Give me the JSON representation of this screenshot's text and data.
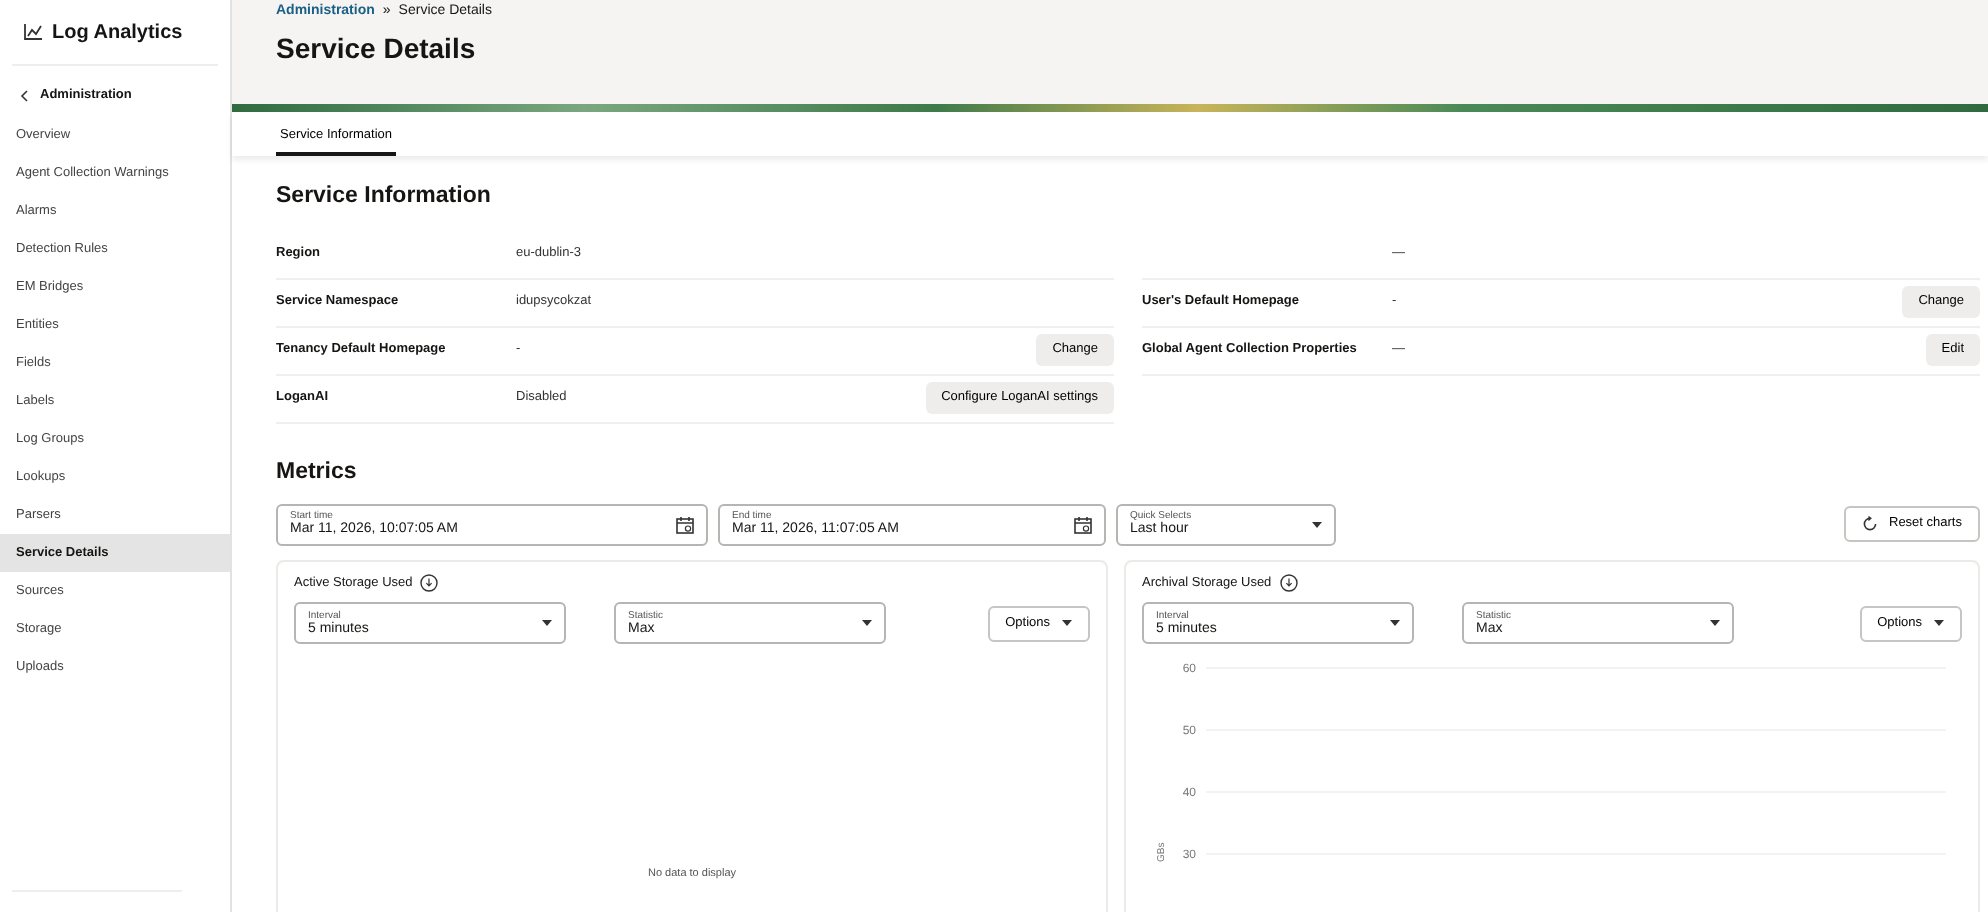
{
  "app": {
    "title": "Log Analytics"
  },
  "sidebar": {
    "back_label": "Administration",
    "items": [
      {
        "label": "Overview",
        "selected": false
      },
      {
        "label": "Agent Collection Warnings",
        "selected": false
      },
      {
        "label": "Alarms",
        "selected": false
      },
      {
        "label": "Detection Rules",
        "selected": false
      },
      {
        "label": "EM Bridges",
        "selected": false
      },
      {
        "label": "Entities",
        "selected": false
      },
      {
        "label": "Fields",
        "selected": false
      },
      {
        "label": "Labels",
        "selected": false
      },
      {
        "label": "Log Groups",
        "selected": false
      },
      {
        "label": "Lookups",
        "selected": false
      },
      {
        "label": "Parsers",
        "selected": false
      },
      {
        "label": "Service Details",
        "selected": true
      },
      {
        "label": "Sources",
        "selected": false
      },
      {
        "label": "Storage",
        "selected": false
      },
      {
        "label": "Uploads",
        "selected": false
      }
    ]
  },
  "breadcrumb": [
    {
      "label": "Administration",
      "kind": "link"
    },
    {
      "separator": "»",
      "label": "Service Details",
      "kind": "current"
    }
  ],
  "page_title": "Service Details",
  "tabs": [
    {
      "label": "Service Information",
      "selected": true
    }
  ],
  "service_information": {
    "title": "Service Information",
    "left_rows": [
      {
        "label": "Region",
        "value": "eu-dublin-3"
      },
      {
        "label": "Service Namespace",
        "value": "idupsycokzat"
      },
      {
        "label": "Tenancy Default Homepage",
        "value": "-",
        "button": "Change"
      },
      {
        "label": "LoganAI",
        "value": "Disabled",
        "button": "Configure LoganAI settings"
      }
    ],
    "right_rows": [
      {
        "value": "—"
      },
      {
        "label": "User's Default Homepage",
        "value": "-",
        "button": "Change"
      },
      {
        "label": "Global Agent Collection Properties",
        "value": "—",
        "button": "Edit"
      }
    ]
  },
  "metrics": {
    "title": "Metrics",
    "start_time": {
      "label": "Start time",
      "value": "Mar 11, 2026, 10:07:05 AM"
    },
    "end_time": {
      "label": "End time",
      "value": "Mar 11, 2026, 11:07:05 AM"
    },
    "quick_selects": {
      "label": "Quick Selects",
      "value": "Last hour"
    },
    "reset_button": "Reset charts",
    "charts": [
      {
        "title": "Active Storage Used",
        "interval": {
          "label": "Interval",
          "value": "5 minutes"
        },
        "statistic": {
          "label": "Statistic",
          "value": "Max"
        },
        "options_button": "Options",
        "empty_message": "No data to display"
      },
      {
        "title": "Archival Storage Used",
        "interval": {
          "label": "Interval",
          "value": "5 minutes"
        },
        "statistic": {
          "label": "Statistic",
          "value": "Max"
        },
        "options_button": "Options",
        "y_axis": {
          "label": "GBs",
          "ticks": [
            "60",
            "50",
            "40",
            "30"
          ]
        }
      }
    ]
  }
}
